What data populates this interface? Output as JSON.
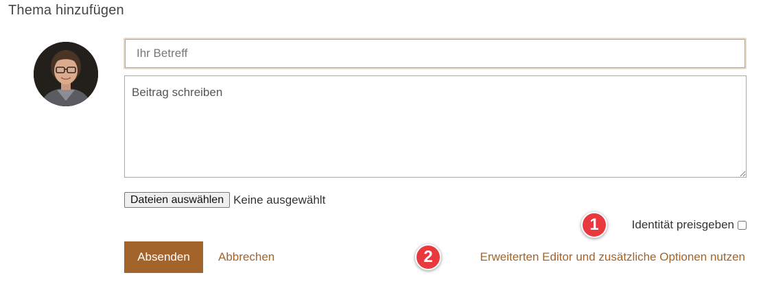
{
  "form": {
    "title": "Thema hinzufügen",
    "subject_placeholder": "Ihr Betreff",
    "message_placeholder": "Beitrag schreiben",
    "file_button_label": "Dateien auswählen",
    "file_status": "Keine ausgewählt",
    "identity_label": "Identität preisgeben",
    "submit_label": "Absenden",
    "cancel_label": "Abbrechen",
    "advanced_label": "Erweiterten Editor und zusätzliche Optionen nutzen"
  },
  "annotations": [
    {
      "number": "1"
    },
    {
      "number": "2"
    }
  ],
  "colors": {
    "accent": "#a3642b",
    "badge": "#e8393f",
    "subject_focus_border": "#ecd9c4"
  },
  "icons": {
    "avatar": "user-avatar-photo"
  }
}
